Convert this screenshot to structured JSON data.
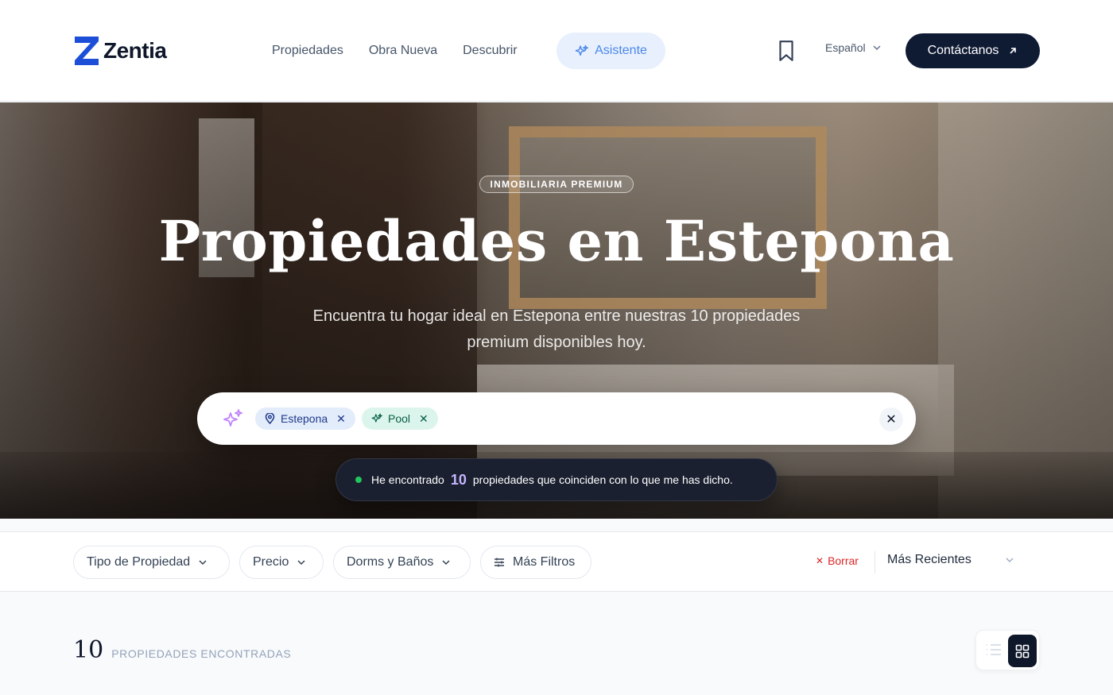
{
  "brand": {
    "name": "Zentia",
    "color": "#1d4ed8"
  },
  "nav": {
    "links": [
      "Propiedades",
      "Obra Nueva",
      "Descubrir"
    ],
    "assistant_label": "Asistente",
    "language": "Español",
    "contact_label": "Contáctanos"
  },
  "hero": {
    "badge": "INMOBILIARIA PREMIUM",
    "title": "Propiedades en Estepona",
    "subtitle": "Encuentra tu hogar ideal en Estepona entre nuestras 10 propiedades premium disponibles hoy."
  },
  "search": {
    "chips": [
      {
        "label": "Estepona",
        "icon": "location-pin-icon"
      },
      {
        "label": "Pool",
        "icon": "sparkle-icon"
      }
    ]
  },
  "result": {
    "prefix": "He encontrado",
    "count": "10",
    "suffix": "propiedades que coinciden con lo que me has dicho."
  },
  "filters": {
    "buttons": [
      "Tipo de Propiedad",
      "Precio",
      "Dorms y Baños",
      "Más Filtros"
    ],
    "clear_label": "Borrar",
    "sort_value": "Más Recientes"
  },
  "results": {
    "count": "10",
    "label": "PROPIEDADES ENCONTRADAS",
    "active_view": "grid"
  },
  "colors": {
    "accent": "#4a88ea",
    "dark": "#0f1a33",
    "danger": "#dc2626",
    "success": "#22c55e"
  }
}
